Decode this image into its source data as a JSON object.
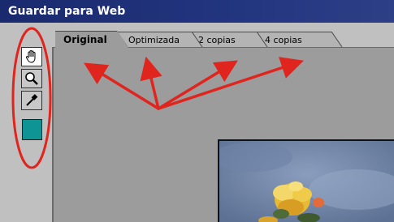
{
  "window": {
    "title": "Guardar para Web"
  },
  "tabs": [
    {
      "label": "Original",
      "selected": true
    },
    {
      "label": "Optimizada",
      "selected": false
    },
    {
      "label": "2 copias",
      "selected": false
    },
    {
      "label": "4 copias",
      "selected": false
    }
  ],
  "toolbox": {
    "tools": [
      {
        "name": "hand-tool",
        "icon": "hand-icon",
        "active": true
      },
      {
        "name": "zoom-tool",
        "icon": "magnifier-icon",
        "active": false
      },
      {
        "name": "eyedropper-tool",
        "icon": "eyedropper-icon",
        "active": false
      }
    ],
    "color_swatch": "#0e9494"
  },
  "colors": {
    "title_bar": "#1a2a6e",
    "annotation_red": "#e0251e",
    "workarea": "#9c9c9c"
  }
}
